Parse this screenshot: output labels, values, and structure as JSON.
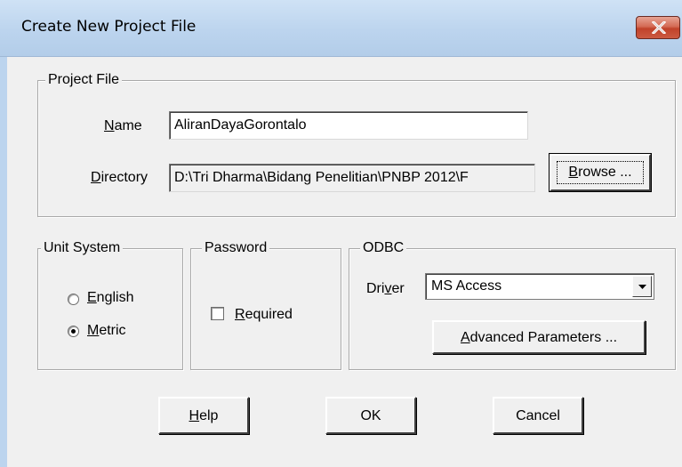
{
  "window": {
    "title": "Create New Project File",
    "close_icon": "close-x-icon"
  },
  "project_file": {
    "legend": "Project File",
    "name_label_prefix": "",
    "name_label_mnemonic": "N",
    "name_label_rest": "ame",
    "name_value": "AliranDayaGorontalo",
    "directory_label_mnemonic": "D",
    "directory_label_rest": "irectory",
    "directory_value": "D:\\Tri Dharma\\Bidang Penelitian\\PNBP 2012\\F",
    "browse_mnemonic": "B",
    "browse_rest": "rowse ..."
  },
  "unit_system": {
    "legend": "Unit System",
    "options": [
      {
        "mnemonic": "E",
        "rest": "nglish",
        "selected": false
      },
      {
        "mnemonic": "M",
        "rest": "etric",
        "selected": true
      }
    ]
  },
  "password": {
    "legend": "Password",
    "required_mnemonic": "R",
    "required_rest": "equired",
    "checked": false
  },
  "odbc": {
    "legend": "ODBC",
    "driver_label_pre": "Dri",
    "driver_label_mnemonic": "v",
    "driver_label_post": "er",
    "driver_value": "MS Access",
    "advanced_mnemonic": "A",
    "advanced_rest": "dvanced Parameters ..."
  },
  "buttons": {
    "help_mnemonic": "H",
    "help_rest": "elp",
    "ok": "OK",
    "cancel": "Cancel"
  }
}
